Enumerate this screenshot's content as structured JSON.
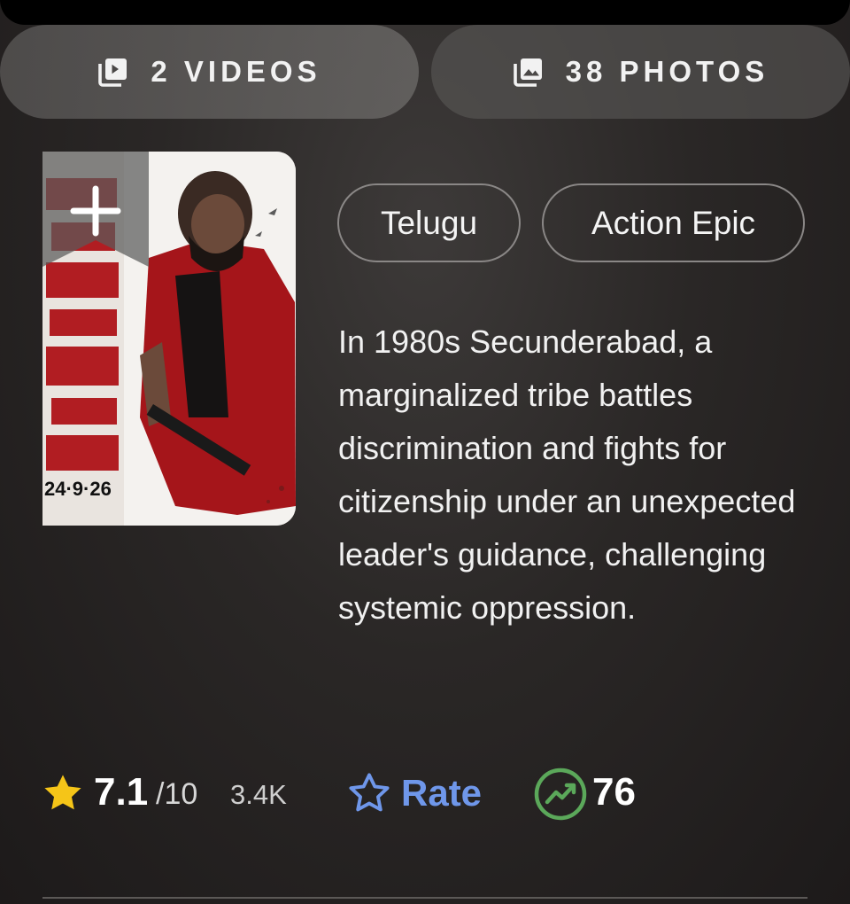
{
  "media": {
    "videos_label": "2 VIDEOS",
    "photos_label": "38 PHOTOS",
    "videos_icon": "video-library-icon",
    "photos_icon": "photo-library-icon"
  },
  "poster": {
    "date_text": "24·9·26",
    "watchlist_icon": "plus-icon"
  },
  "genres": [
    "Telugu",
    "Action Epic"
  ],
  "plot": "In 1980s Secunderabad, a marginalized tribe battles discrimination and fights for citizenship under an unexpected leader's guidance, challenging systemic oppression.",
  "rating": {
    "score": "7.1",
    "out_of": "/10",
    "votes": "3.4K",
    "rate_label": "Rate",
    "meter_rank": "76"
  },
  "colors": {
    "star_gold": "#f5c518",
    "rate_blue": "#6f97ea",
    "trend_green": "#5ba85a"
  }
}
